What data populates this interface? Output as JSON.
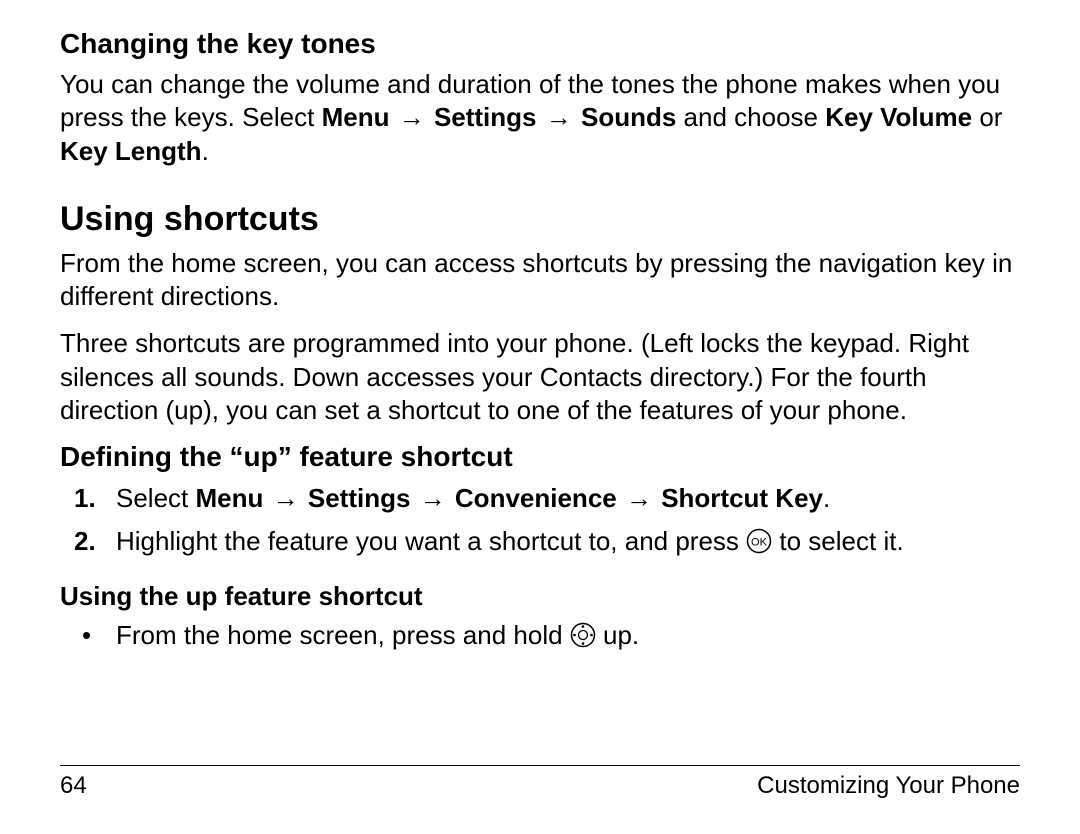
{
  "sec1": {
    "heading": "Changing the key tones",
    "p1a": "You can change the volume and duration of the tones the phone makes when you press the keys. Select",
    "menu": "Menu",
    "settings": "Settings",
    "sounds": "Sounds",
    "p1b": " and choose ",
    "kv": "Key Volume",
    "or": " or ",
    "kl": "Key Length",
    "end": "."
  },
  "sec2": {
    "heading": "Using shortcuts",
    "p1": "From the home screen, you can access shortcuts by pressing the navigation key in different directions.",
    "p2": "Three shortcuts are programmed into your phone. (Left locks the keypad. Right silences all sounds. Down accesses your Contacts directory.) For the fourth direction (up), you can set a shortcut to one of the features of your phone."
  },
  "sec3": {
    "heading": "Defining the “up” feature shortcut",
    "step1_pre": "Select ",
    "menu": "Menu",
    "settings": "Settings",
    "conv": "Convenience",
    "sk": "Shortcut Key",
    "step1_end": ".",
    "step2a": "Highlight the feature you want a shortcut to, and press ",
    "step2b": " to select it."
  },
  "sec4": {
    "heading": "Using the up feature shortcut",
    "bullet_a": "From the home screen, press and hold ",
    "bullet_b": " up."
  },
  "arrow": "→",
  "footer": {
    "page": "64",
    "title": "Customizing Your Phone"
  }
}
